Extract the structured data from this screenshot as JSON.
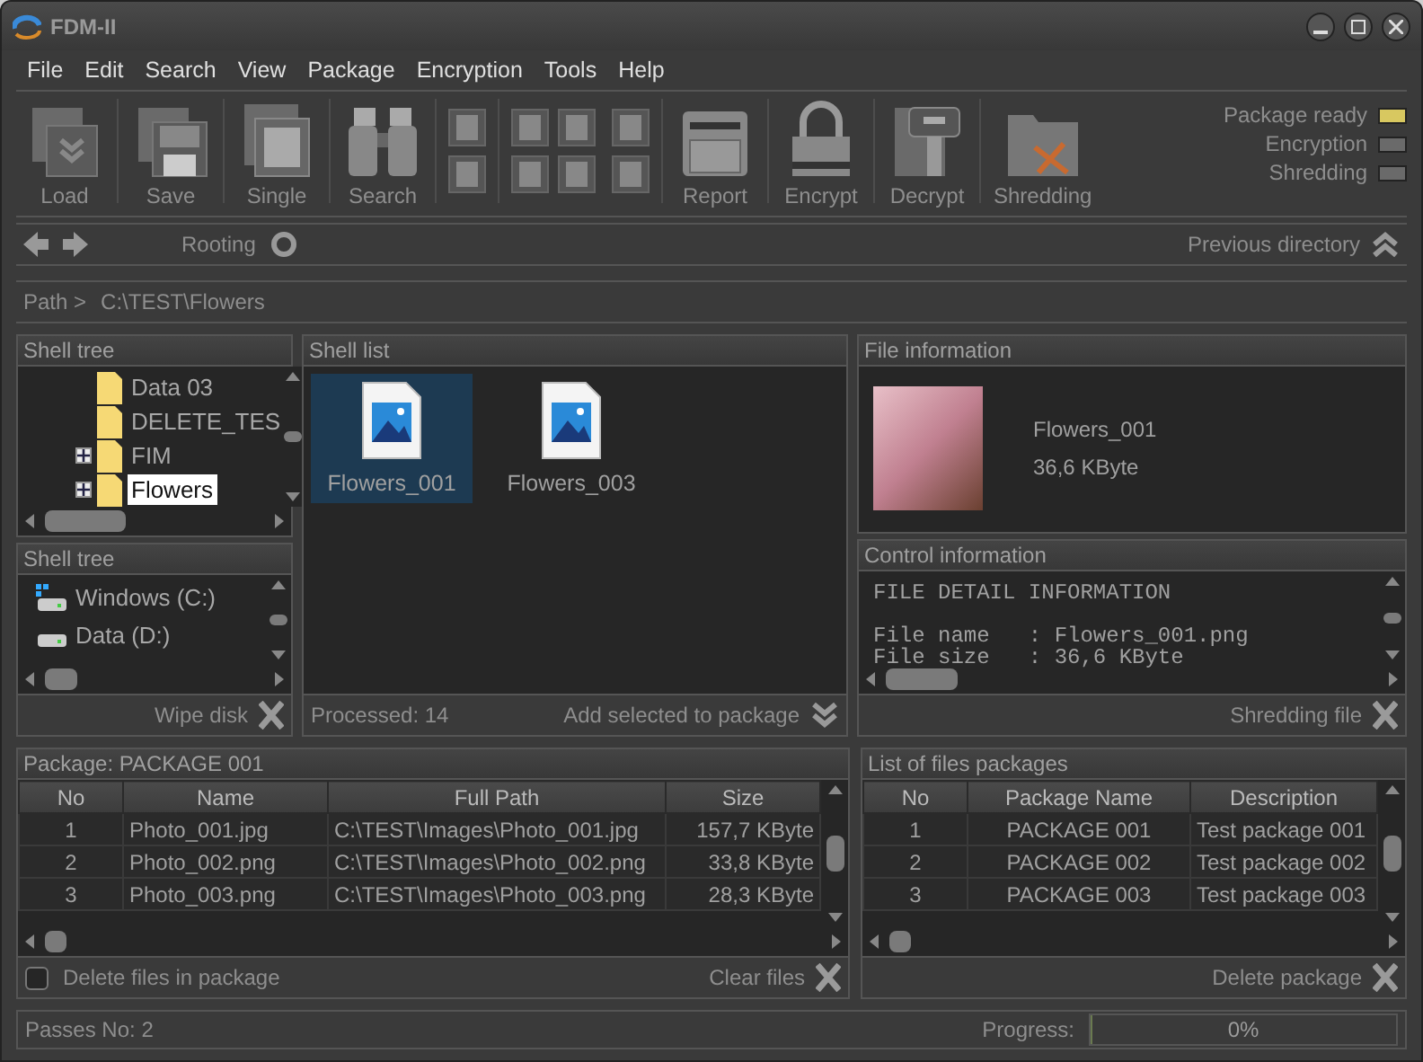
{
  "window": {
    "title": "FDM-II"
  },
  "menu": [
    "File",
    "Edit",
    "Search",
    "View",
    "Package",
    "Encryption",
    "Tools",
    "Help"
  ],
  "toolbar": {
    "left": [
      {
        "kind": "load",
        "label": "Load"
      },
      {
        "kind": "save",
        "label": "Save"
      },
      {
        "kind": "single",
        "label": "Single"
      },
      {
        "kind": "search",
        "label": "Search"
      }
    ],
    "right": [
      {
        "kind": "report",
        "label": "Report"
      },
      {
        "kind": "encrypt",
        "label": "Encrypt"
      },
      {
        "kind": "decrypt",
        "label": "Decrypt"
      },
      {
        "kind": "shred",
        "label": "Shredding"
      }
    ]
  },
  "indicators": [
    {
      "label": "Package ready",
      "on": true
    },
    {
      "label": "Encryption",
      "on": false
    },
    {
      "label": "Shredding",
      "on": false
    }
  ],
  "nav": {
    "rooting": "Rooting",
    "previous": "Previous directory"
  },
  "path": {
    "label": "Path >",
    "value": "C:\\TEST\\Flowers"
  },
  "shell_tree": {
    "title": "Shell tree",
    "items": [
      {
        "label": "Data 03",
        "kind": "leaf",
        "selected": false
      },
      {
        "label": "DELETE_TES",
        "kind": "leaf",
        "selected": false
      },
      {
        "label": "FIM",
        "kind": "collapsed",
        "selected": false
      },
      {
        "label": "Flowers",
        "kind": "collapsed",
        "selected": true
      }
    ]
  },
  "drives": {
    "title": "Shell tree",
    "items": [
      {
        "label": "Windows (C:)",
        "kind": "system"
      },
      {
        "label": "Data (D:)",
        "kind": "disk"
      }
    ],
    "action": "Wipe disk"
  },
  "shell_list": {
    "title": "Shell list",
    "items": [
      {
        "name": "Flowers_001",
        "selected": true
      },
      {
        "name": "Flowers_003",
        "selected": false
      }
    ],
    "status": "Processed: 14",
    "action": "Add selected to package"
  },
  "file_info": {
    "title": "File information",
    "name": "Flowers_001",
    "size": "36,6 KByte"
  },
  "control_info": {
    "title": "Control information",
    "heading": "FILE DETAIL INFORMATION",
    "lines": [
      "File name   : Flowers_001.png",
      "File size   : 36,6 KByte"
    ],
    "action": "Shredding file"
  },
  "package": {
    "title": "Package: PACKAGE 001",
    "columns": [
      "No",
      "Name",
      "Full Path",
      "Size"
    ],
    "rows": [
      [
        "1",
        "Photo_001.jpg",
        "C:\\TEST\\Images\\Photo_001.jpg",
        "157,7 KByte"
      ],
      [
        "2",
        "Photo_002.png",
        "C:\\TEST\\Images\\Photo_002.png",
        "33,8 KByte"
      ],
      [
        "3",
        "Photo_003.png",
        "C:\\TEST\\Images\\Photo_003.png",
        "28,3 KByte"
      ]
    ],
    "delete_option": {
      "label": "Delete files in package",
      "checked": false
    },
    "action": "Clear files"
  },
  "packages": {
    "title": "List of files packages",
    "columns": [
      "No",
      "Package Name",
      "Description"
    ],
    "rows": [
      [
        "1",
        "PACKAGE 001",
        "Test package 001"
      ],
      [
        "2",
        "PACKAGE 002",
        "Test package 002"
      ],
      [
        "3",
        "PACKAGE 003",
        "Test package 003"
      ]
    ],
    "action": "Delete package"
  },
  "status_bar": {
    "passes": "Passes No: 2",
    "progress_label": "Progress:",
    "progress": {
      "level": 0,
      "reading": "0%"
    }
  }
}
